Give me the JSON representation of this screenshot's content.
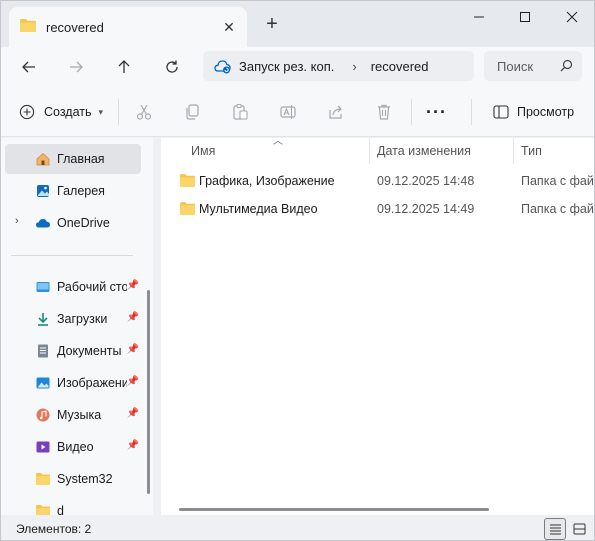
{
  "tab": {
    "title": "recovered",
    "close": "✕",
    "new": "+"
  },
  "window_controls": {
    "minimize": "—",
    "maximize": "☐",
    "close": "✕"
  },
  "address": {
    "crumbs": [
      "Запуск рез. коп.",
      "recovered"
    ],
    "separator": "›"
  },
  "search": {
    "placeholder": "Поиск"
  },
  "toolbar": {
    "create_label": "Создать",
    "more_label": "···",
    "view_label": "Просмотр"
  },
  "sidebar": {
    "items": [
      {
        "label": "Главная",
        "icon": "home-icon",
        "selected": true
      },
      {
        "label": "Галерея",
        "icon": "gallery-icon"
      },
      {
        "label": "OneDrive",
        "icon": "cloud-icon",
        "expandable": true
      },
      {
        "label": "Рабочий стол",
        "icon": "desktop-icon",
        "pinned": true
      },
      {
        "label": "Загрузки",
        "icon": "download-icon",
        "pinned": true
      },
      {
        "label": "Документы",
        "icon": "document-icon",
        "pinned": true
      },
      {
        "label": "Изображения",
        "icon": "image-icon",
        "pinned": true
      },
      {
        "label": "Музыка",
        "icon": "music-icon",
        "pinned": true
      },
      {
        "label": "Видео",
        "icon": "video-icon",
        "pinned": true
      },
      {
        "label": "System32",
        "icon": "folder-icon"
      },
      {
        "label": "d",
        "icon": "folder-icon"
      }
    ]
  },
  "columns": {
    "name": "Имя",
    "date": "Дата изменения",
    "type": "Тип"
  },
  "files": [
    {
      "name": "Графика, Изображение",
      "date": "09.12.2025 14:48",
      "type": "Папка с файлами"
    },
    {
      "name": "Мультимедиа Видео",
      "date": "09.12.2025 14:49",
      "type": "Папка с файлами"
    }
  ],
  "status": {
    "count_text": "Элементов: 2"
  },
  "colors": {
    "folder": "#f4c44e",
    "accent": "#0067c0"
  }
}
